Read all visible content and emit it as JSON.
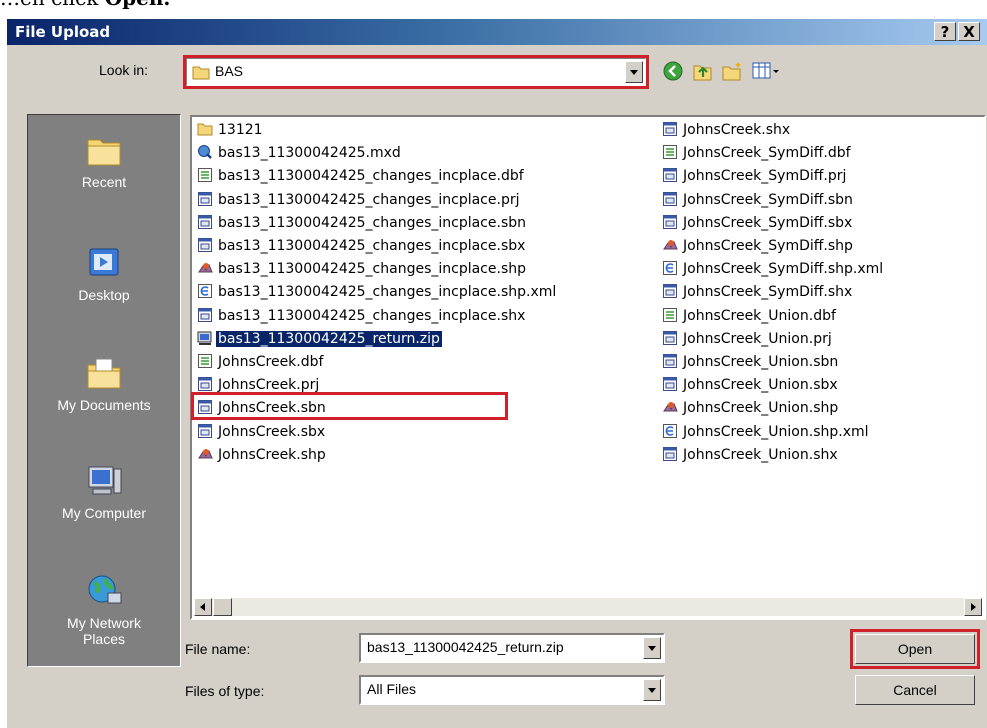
{
  "caption": {
    "prefix": "…en click ",
    "bold": "Open."
  },
  "dialog": {
    "title": "File Upload",
    "help_label": "?",
    "close_label": "X"
  },
  "look_in": {
    "label": "Look in:",
    "value": "BAS"
  },
  "places": [
    {
      "label": "Recent",
      "icon": "recent-folder-icon"
    },
    {
      "label": "Desktop",
      "icon": "desktop-icon"
    },
    {
      "label": "My Documents",
      "icon": "my-documents-icon"
    },
    {
      "label": "My Computer",
      "icon": "my-computer-icon"
    },
    {
      "label": "My Network Places",
      "icon": "network-places-icon"
    }
  ],
  "files_left": [
    {
      "name": "13121",
      "type": "folder"
    },
    {
      "name": "bas13_11300042425.mxd",
      "type": "mxd"
    },
    {
      "name": "bas13_11300042425_changes_incplace.dbf",
      "type": "dbf"
    },
    {
      "name": "bas13_11300042425_changes_incplace.prj",
      "type": "generic"
    },
    {
      "name": "bas13_11300042425_changes_incplace.sbn",
      "type": "generic"
    },
    {
      "name": "bas13_11300042425_changes_incplace.sbx",
      "type": "generic"
    },
    {
      "name": "bas13_11300042425_changes_incplace.shp",
      "type": "shp"
    },
    {
      "name": "bas13_11300042425_changes_incplace.shp.xml",
      "type": "xml"
    },
    {
      "name": "bas13_11300042425_changes_incplace.shx",
      "type": "generic"
    },
    {
      "name": "bas13_11300042425_return.zip",
      "type": "zip",
      "selected": true
    },
    {
      "name": "JohnsCreek.dbf",
      "type": "dbf"
    },
    {
      "name": "JohnsCreek.prj",
      "type": "generic"
    },
    {
      "name": "JohnsCreek.sbn",
      "type": "generic"
    },
    {
      "name": "JohnsCreek.sbx",
      "type": "generic"
    },
    {
      "name": "JohnsCreek.shp",
      "type": "shp"
    }
  ],
  "files_right": [
    {
      "name": "JohnsCreek.shx",
      "type": "generic"
    },
    {
      "name": "JohnsCreek_SymDiff.dbf",
      "type": "dbf"
    },
    {
      "name": "JohnsCreek_SymDiff.prj",
      "type": "generic"
    },
    {
      "name": "JohnsCreek_SymDiff.sbn",
      "type": "generic"
    },
    {
      "name": "JohnsCreek_SymDiff.sbx",
      "type": "generic"
    },
    {
      "name": "JohnsCreek_SymDiff.shp",
      "type": "shp"
    },
    {
      "name": "JohnsCreek_SymDiff.shp.xml",
      "type": "xml"
    },
    {
      "name": "JohnsCreek_SymDiff.shx",
      "type": "generic"
    },
    {
      "name": "JohnsCreek_Union.dbf",
      "type": "dbf"
    },
    {
      "name": "JohnsCreek_Union.prj",
      "type": "generic"
    },
    {
      "name": "JohnsCreek_Union.sbn",
      "type": "generic"
    },
    {
      "name": "JohnsCreek_Union.sbx",
      "type": "generic"
    },
    {
      "name": "JohnsCreek_Union.shp",
      "type": "shp"
    },
    {
      "name": "JohnsCreek_Union.shp.xml",
      "type": "xml"
    },
    {
      "name": "JohnsCreek_Union.shx",
      "type": "generic"
    }
  ],
  "file_name": {
    "label": "File name:",
    "value": "bas13_11300042425_return.zip"
  },
  "file_type": {
    "label": "Files of type:",
    "value": "All Files"
  },
  "buttons": {
    "open": "Open",
    "cancel": "Cancel"
  },
  "colors": {
    "highlight": "#d0202a",
    "selection": "#0a246a",
    "dialog_bg": "#d4d0c8",
    "places_bg": "#808080"
  }
}
